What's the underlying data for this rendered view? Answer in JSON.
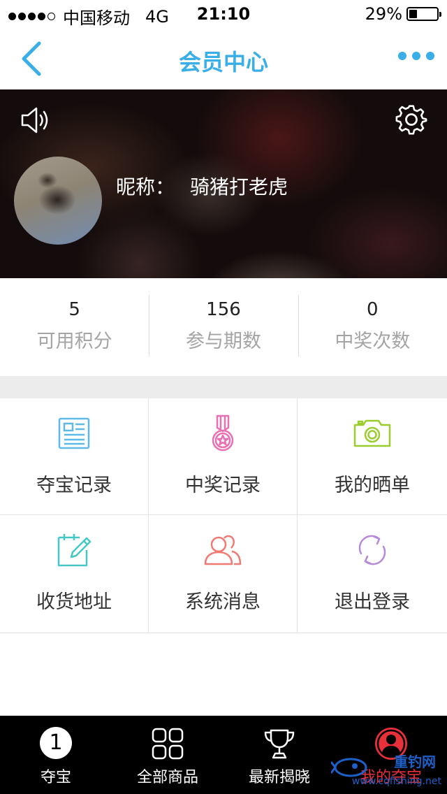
{
  "status_bar": {
    "carrier": "中国移动",
    "network": "4G",
    "time": "21:10",
    "battery_percent": "29%",
    "battery_level": 0.29,
    "signal_bars": 4
  },
  "nav": {
    "title": "会员中心",
    "accent_color": "#3aaee6"
  },
  "profile": {
    "nickname_label": "昵称：",
    "nickname": "骑猪打老虎"
  },
  "stats": [
    {
      "value": "5",
      "label": "可用积分"
    },
    {
      "value": "156",
      "label": "参与期数"
    },
    {
      "value": "0",
      "label": "中奖次数"
    }
  ],
  "menu": [
    {
      "label": "夺宝记录",
      "icon": "newspaper-icon",
      "color": "#5fb9e6"
    },
    {
      "label": "中奖记录",
      "icon": "medal-icon",
      "color": "#ea6fb3"
    },
    {
      "label": "我的晒单",
      "icon": "camera-icon",
      "color": "#9ccd2e"
    },
    {
      "label": "收货地址",
      "icon": "edit-note-icon",
      "color": "#45c8c4"
    },
    {
      "label": "系统消息",
      "icon": "users-icon",
      "color": "#ef7a73"
    },
    {
      "label": "退出登录",
      "icon": "refresh-icon",
      "color": "#b58ad8"
    }
  ],
  "tabs": [
    {
      "label": "夺宝",
      "icon": "number-one-icon",
      "badge": "1"
    },
    {
      "label": "全部商品",
      "icon": "grid-icon"
    },
    {
      "label": "最新揭晓",
      "icon": "trophy-icon"
    },
    {
      "label": "我的夺宝",
      "icon": "user-icon",
      "active": true,
      "active_color": "#e8303a"
    }
  ],
  "watermark": {
    "brand": "重钓网",
    "url": "www.cqfishing.net"
  }
}
